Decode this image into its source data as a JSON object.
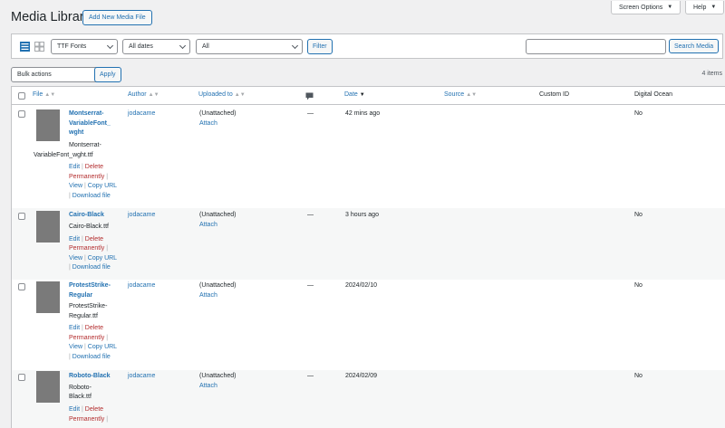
{
  "header": {
    "title": "Media Library",
    "add_new_label": "Add New Media File",
    "screen_options_label": "Screen Options",
    "help_label": "Help"
  },
  "filters": {
    "type_value": "TTF Fonts",
    "dates_value": "All dates",
    "all_value": "All",
    "filter_label": "Filter",
    "search_value": "",
    "search_label": "Search Media"
  },
  "bulk": {
    "selected": "Bulk actions",
    "apply_label": "Apply",
    "items_count": "4 items"
  },
  "columns": {
    "file": "File",
    "author": "Author",
    "uploaded_to": "Uploaded to",
    "comments_icon": "comment-icon",
    "date": "Date",
    "source": "Source",
    "custom_id": "Custom ID",
    "digital_ocean": "Digital Ocean"
  },
  "rows": [
    {
      "title_lines": [
        "Montserrat-",
        "VariableFont_",
        "wght"
      ],
      "file_lines": [
        "Montserrat-",
        "VariableFont_wght.ttf"
      ],
      "author": "jodacame",
      "uploaded_to": "(Unattached)",
      "attach": "Attach",
      "comments": "—",
      "date": "42 mins ago",
      "digital_ocean": "No"
    },
    {
      "title_lines": [
        "Cairo-Black"
      ],
      "file_lines": [
        "Cairo-Black.ttf"
      ],
      "author": "jodacame",
      "uploaded_to": "(Unattached)",
      "attach": "Attach",
      "comments": "—",
      "date": "3 hours ago",
      "digital_ocean": "No"
    },
    {
      "title_lines": [
        "ProtestStrike-",
        "Regular"
      ],
      "file_lines": [
        "ProtestStrike-",
        "Regular.ttf"
      ],
      "author": "jodacame",
      "uploaded_to": "(Unattached)",
      "attach": "Attach",
      "comments": "—",
      "date": "2024/02/10",
      "digital_ocean": "No"
    },
    {
      "title_lines": [
        "Roboto-Black"
      ],
      "file_lines": [
        "Roboto-",
        "Black.ttf"
      ],
      "author": "jodacame",
      "uploaded_to": "(Unattached)",
      "attach": "Attach",
      "comments": "—",
      "date": "2024/02/09",
      "digital_ocean": "No"
    }
  ],
  "row_actions": {
    "edit": "Edit",
    "sep": "|",
    "delete_1": "Delete",
    "delete_2": "Permanently",
    "view": "View",
    "copy_url": "Copy URL",
    "download": "Download file"
  }
}
